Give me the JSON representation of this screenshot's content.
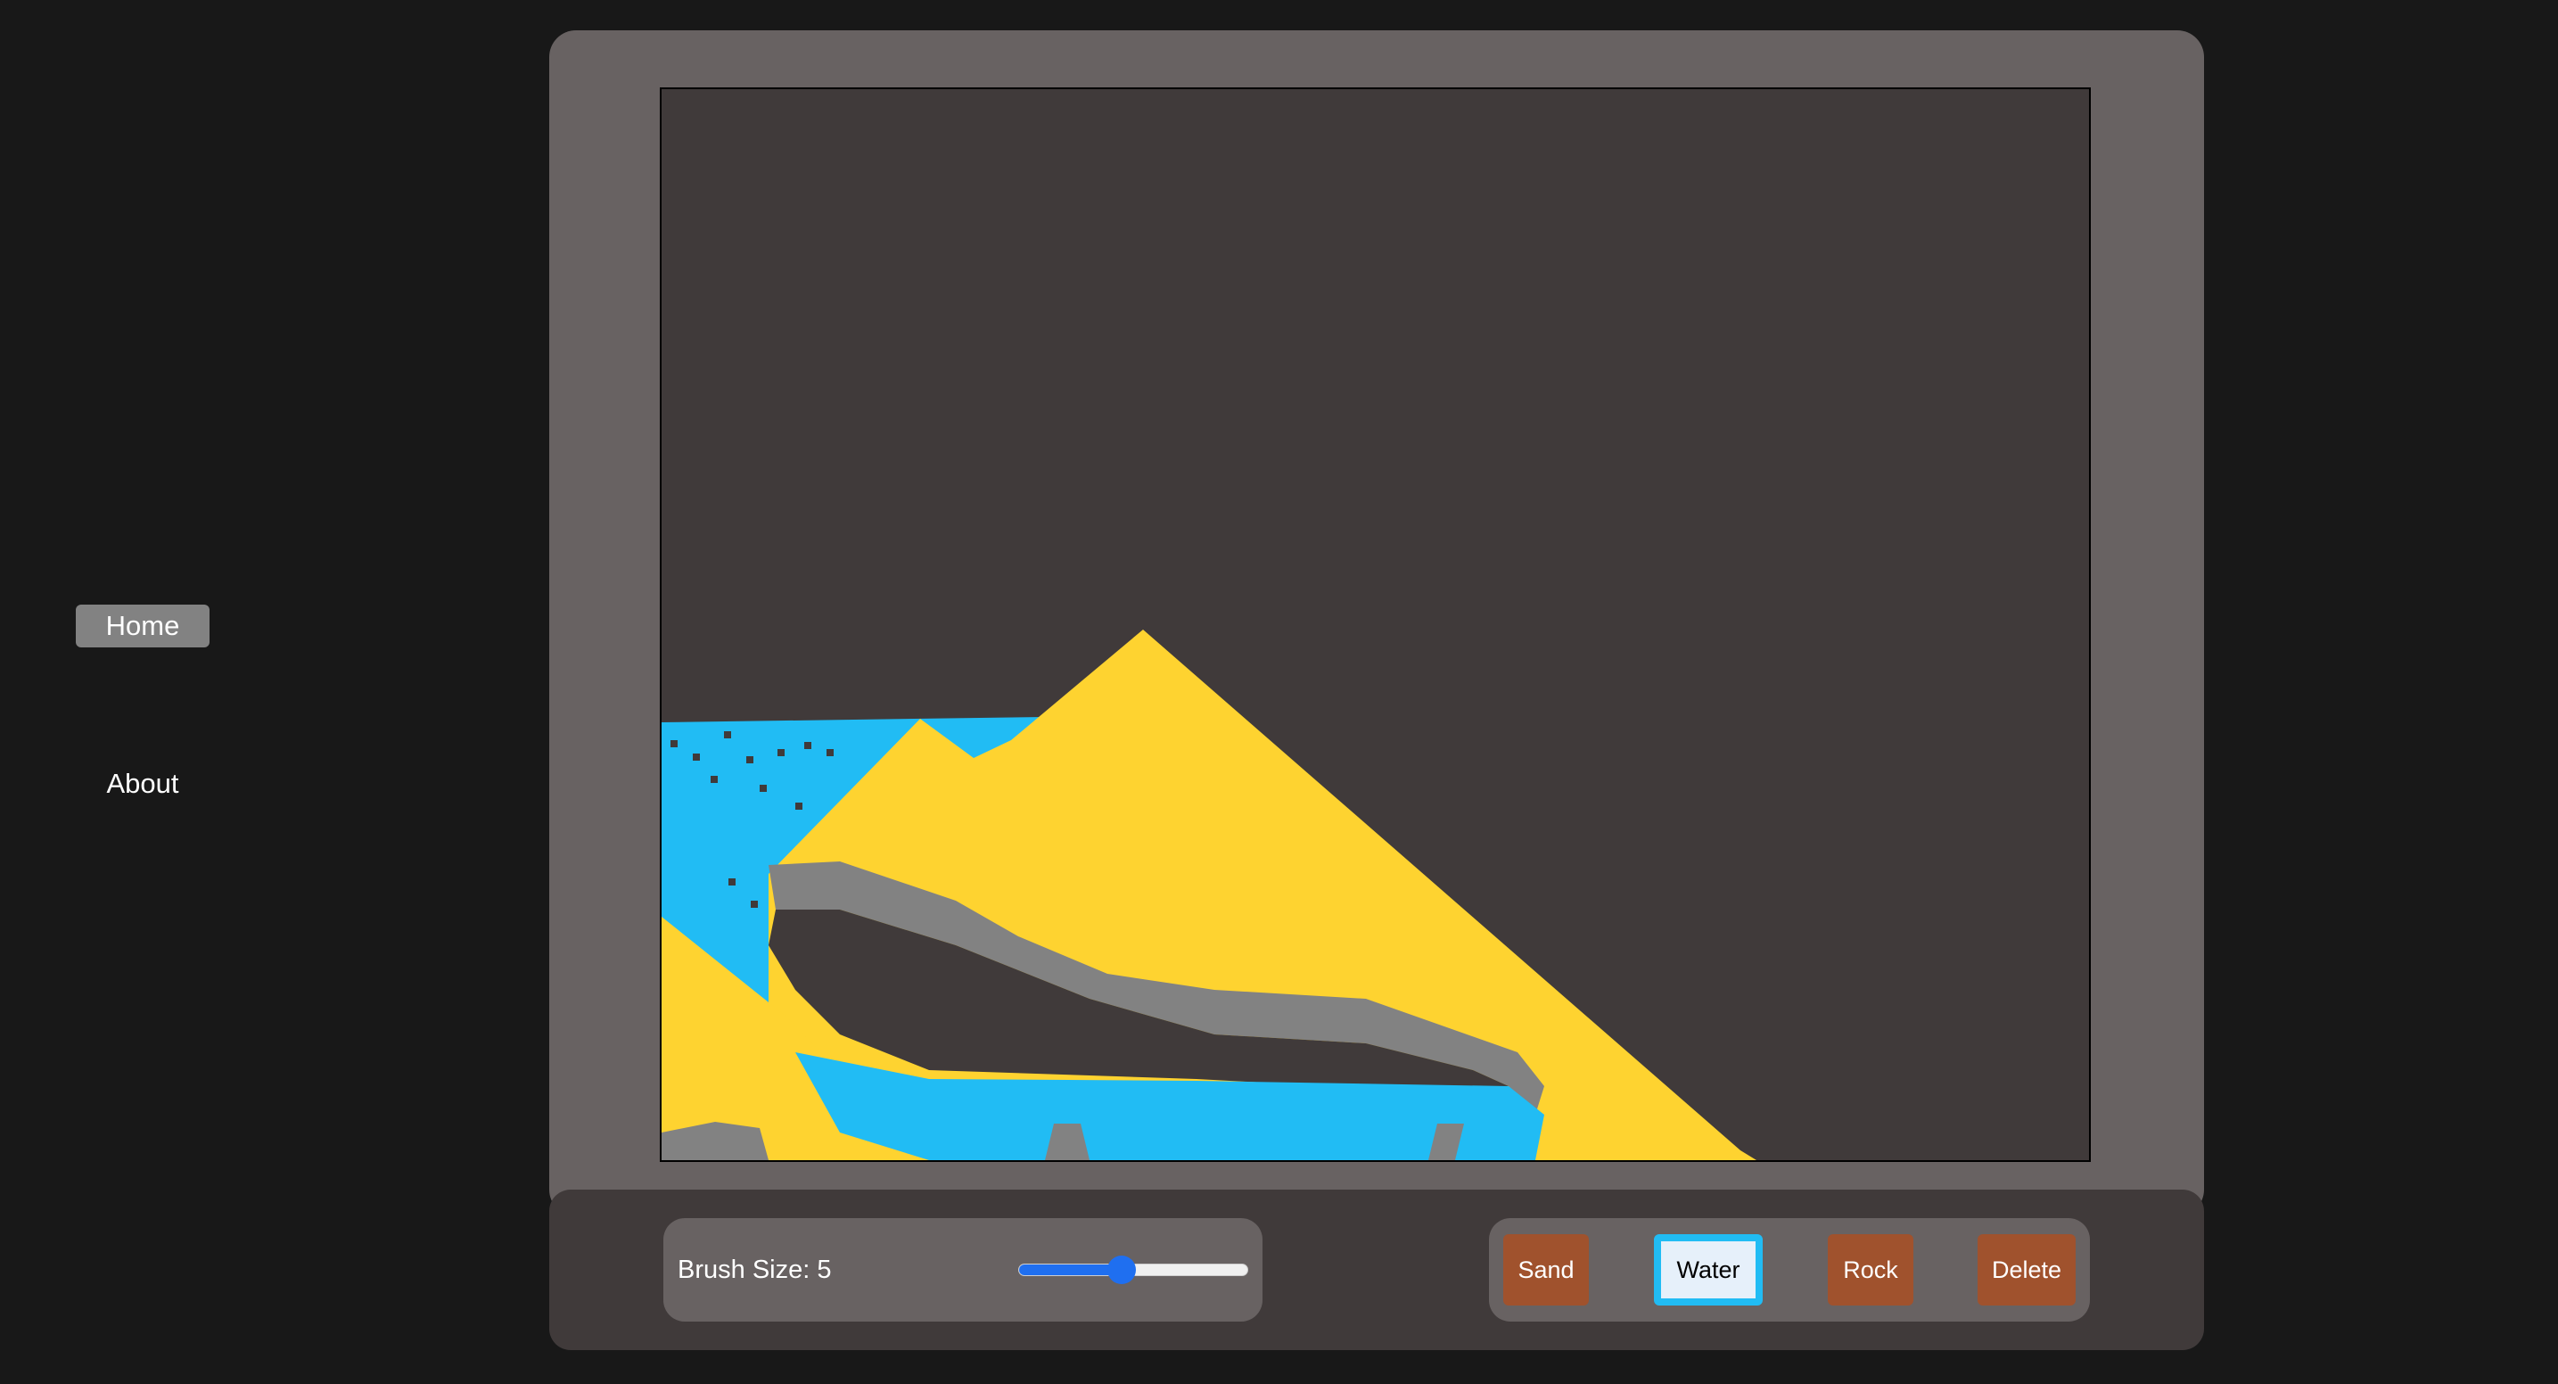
{
  "nav": {
    "items": [
      {
        "label": "Home",
        "active": true
      },
      {
        "label": "About",
        "active": false
      }
    ]
  },
  "controls": {
    "brush_label": "Brush Size: 5",
    "brush_size": 5,
    "brush_min": 1,
    "brush_max": 10,
    "tools": [
      {
        "label": "Sand",
        "selected": false
      },
      {
        "label": "Water",
        "selected": true
      },
      {
        "label": "Rock",
        "selected": false
      },
      {
        "label": "Delete",
        "selected": false
      }
    ]
  },
  "colors": {
    "page_background": "#181818",
    "frame": "#686262",
    "canvas_background": "#403a3a",
    "sand": "#fed330",
    "water": "#21bcf4",
    "rock": "#828282",
    "tool_button": "#a0522d",
    "selected_tool_border": "#21bcf4",
    "slider_accent": "#1f6ff0"
  },
  "icons": {
    "canvas": "sand-simulation-canvas"
  }
}
